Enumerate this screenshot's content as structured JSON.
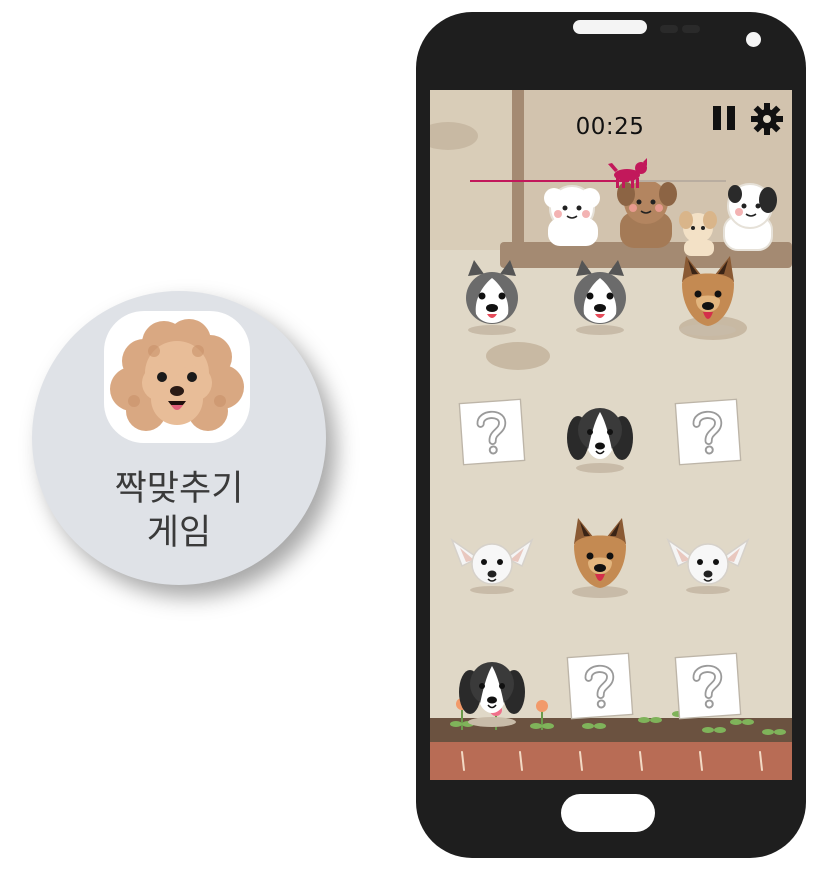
{
  "app_icon": {
    "name_line1": "짝맞추기",
    "name_line2": "게임",
    "icon": "poodle-face-icon"
  },
  "game": {
    "timer": "00:25",
    "pause_icon": "pause-icon",
    "settings_icon": "gear-icon",
    "time_progress": 0.62,
    "progress_color": "#c2185b",
    "background_color": "#e0d8c7",
    "cards": [
      {
        "row": 0,
        "col": 0,
        "state": "revealed",
        "dog": "husky-dog-icon"
      },
      {
        "row": 0,
        "col": 1,
        "state": "revealed",
        "dog": "husky-dog-icon"
      },
      {
        "row": 0,
        "col": 2,
        "state": "revealed",
        "dog": "shepherd-dog-icon"
      },
      {
        "row": 1,
        "col": 0,
        "state": "hidden",
        "dog": "question-mark-icon"
      },
      {
        "row": 1,
        "col": 1,
        "state": "revealed",
        "dog": "spaniel-dog-icon"
      },
      {
        "row": 1,
        "col": 2,
        "state": "hidden",
        "dog": "question-mark-icon"
      },
      {
        "row": 2,
        "col": 0,
        "state": "revealed",
        "dog": "chihuahua-dog-icon"
      },
      {
        "row": 2,
        "col": 1,
        "state": "revealed",
        "dog": "shepherd-dog-icon"
      },
      {
        "row": 2,
        "col": 2,
        "state": "revealed",
        "dog": "chihuahua-dog-icon"
      },
      {
        "row": 3,
        "col": 0,
        "state": "revealed",
        "dog": "spaniel-dog-icon"
      },
      {
        "row": 3,
        "col": 1,
        "state": "hidden",
        "dog": "question-mark-icon"
      },
      {
        "row": 3,
        "col": 2,
        "state": "hidden",
        "dog": "question-mark-icon"
      }
    ]
  }
}
